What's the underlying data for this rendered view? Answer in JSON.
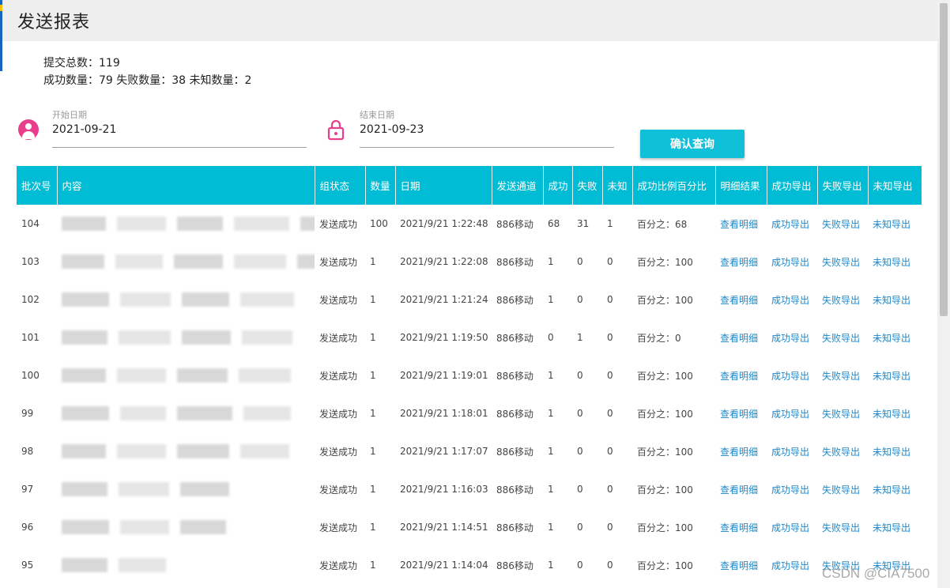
{
  "header": {
    "title": "发送报表"
  },
  "summary": {
    "submitted": "提交总数：119",
    "counts": "成功数量：79 失败数量：38 未知数量：2"
  },
  "filters": {
    "start": {
      "label": "开始日期",
      "value": "2021-09-21",
      "icon": "person-icon"
    },
    "end": {
      "label": "结束日期",
      "value": "2021-09-23",
      "icon": "lock-icon"
    },
    "query_button": "确认查询"
  },
  "table": {
    "columns": [
      "批次号",
      "内容",
      "组状态",
      "数量",
      "日期",
      "发送通道",
      "成功",
      "失败",
      "未知",
      "成功比例百分比",
      "明细结果",
      "成功导出",
      "失败导出",
      "未知导出"
    ],
    "rows": [
      {
        "batch": "104",
        "content_tail": "45",
        "status": "发送成功",
        "qty": "100",
        "date": "2021/9/21 1:22:48",
        "channel": "886移动",
        "success": "68",
        "fail": "31",
        "unknown": "1",
        "ratio": "百分之：68",
        "detail": "查看明细",
        "exp_success": "成功导出",
        "exp_fail": "失败导出",
        "exp_unknown": "未知导出"
      },
      {
        "batch": "103",
        "content_tail": "445",
        "status": "发送成功",
        "qty": "1",
        "date": "2021/9/21 1:22:08",
        "channel": "886移动",
        "success": "1",
        "fail": "0",
        "unknown": "0",
        "ratio": "百分之：100",
        "detail": "查看明细",
        "exp_success": "成功导出",
        "exp_fail": "失败导出",
        "exp_unknown": "未知导出"
      },
      {
        "batch": "102",
        "content_tail": "",
        "status": "发送成功",
        "qty": "1",
        "date": "2021/9/21 1:21:24",
        "channel": "886移动",
        "success": "1",
        "fail": "0",
        "unknown": "0",
        "ratio": "百分之：100",
        "detail": "查看明细",
        "exp_success": "成功导出",
        "exp_fail": "失败导出",
        "exp_unknown": "未知导出"
      },
      {
        "batch": "101",
        "content_tail": "",
        "status": "发送成功",
        "qty": "1",
        "date": "2021/9/21 1:19:50",
        "channel": "886移动",
        "success": "0",
        "fail": "1",
        "unknown": "0",
        "ratio": "百分之：0",
        "detail": "查看明细",
        "exp_success": "成功导出",
        "exp_fail": "失败导出",
        "exp_unknown": "未知导出"
      },
      {
        "batch": "100",
        "content_tail": "",
        "status": "发送成功",
        "qty": "1",
        "date": "2021/9/21 1:19:01",
        "channel": "886移动",
        "success": "1",
        "fail": "0",
        "unknown": "0",
        "ratio": "百分之：100",
        "detail": "查看明细",
        "exp_success": "成功导出",
        "exp_fail": "失败导出",
        "exp_unknown": "未知导出"
      },
      {
        "batch": "99",
        "content_tail": "",
        "status": "发送成功",
        "qty": "1",
        "date": "2021/9/21 1:18:01",
        "channel": "886移动",
        "success": "1",
        "fail": "0",
        "unknown": "0",
        "ratio": "百分之：100",
        "detail": "查看明细",
        "exp_success": "成功导出",
        "exp_fail": "失败导出",
        "exp_unknown": "未知导出"
      },
      {
        "batch": "98",
        "content_tail": "",
        "status": "发送成功",
        "qty": "1",
        "date": "2021/9/21 1:17:07",
        "channel": "886移动",
        "success": "1",
        "fail": "0",
        "unknown": "0",
        "ratio": "百分之：100",
        "detail": "查看明细",
        "exp_success": "成功导出",
        "exp_fail": "失败导出",
        "exp_unknown": "未知导出"
      },
      {
        "batch": "97",
        "content_tail": "",
        "status": "发送成功",
        "qty": "1",
        "date": "2021/9/21 1:16:03",
        "channel": "886移动",
        "success": "1",
        "fail": "0",
        "unknown": "0",
        "ratio": "百分之：100",
        "detail": "查看明细",
        "exp_success": "成功导出",
        "exp_fail": "失败导出",
        "exp_unknown": "未知导出"
      },
      {
        "batch": "96",
        "content_tail": "",
        "status": "发送成功",
        "qty": "1",
        "date": "2021/9/21 1:14:51",
        "channel": "886移动",
        "success": "1",
        "fail": "0",
        "unknown": "0",
        "ratio": "百分之：100",
        "detail": "查看明细",
        "exp_success": "成功导出",
        "exp_fail": "失败导出",
        "exp_unknown": "未知导出"
      },
      {
        "batch": "95",
        "content_tail": "",
        "status": "发送成功",
        "qty": "1",
        "date": "2021/9/21 1:14:04",
        "channel": "886移动",
        "success": "1",
        "fail": "0",
        "unknown": "0",
        "ratio": "百分之：100",
        "detail": "查看明细",
        "exp_success": "成功导出",
        "exp_fail": "失败导出",
        "exp_unknown": "未知导出"
      }
    ]
  },
  "watermark": "CSDN @CIA7500",
  "colors": {
    "header_bg": "#00bcd4",
    "button": "#10c0d8",
    "link": "#1e88c8",
    "icon_pink": "#e83e8c"
  }
}
